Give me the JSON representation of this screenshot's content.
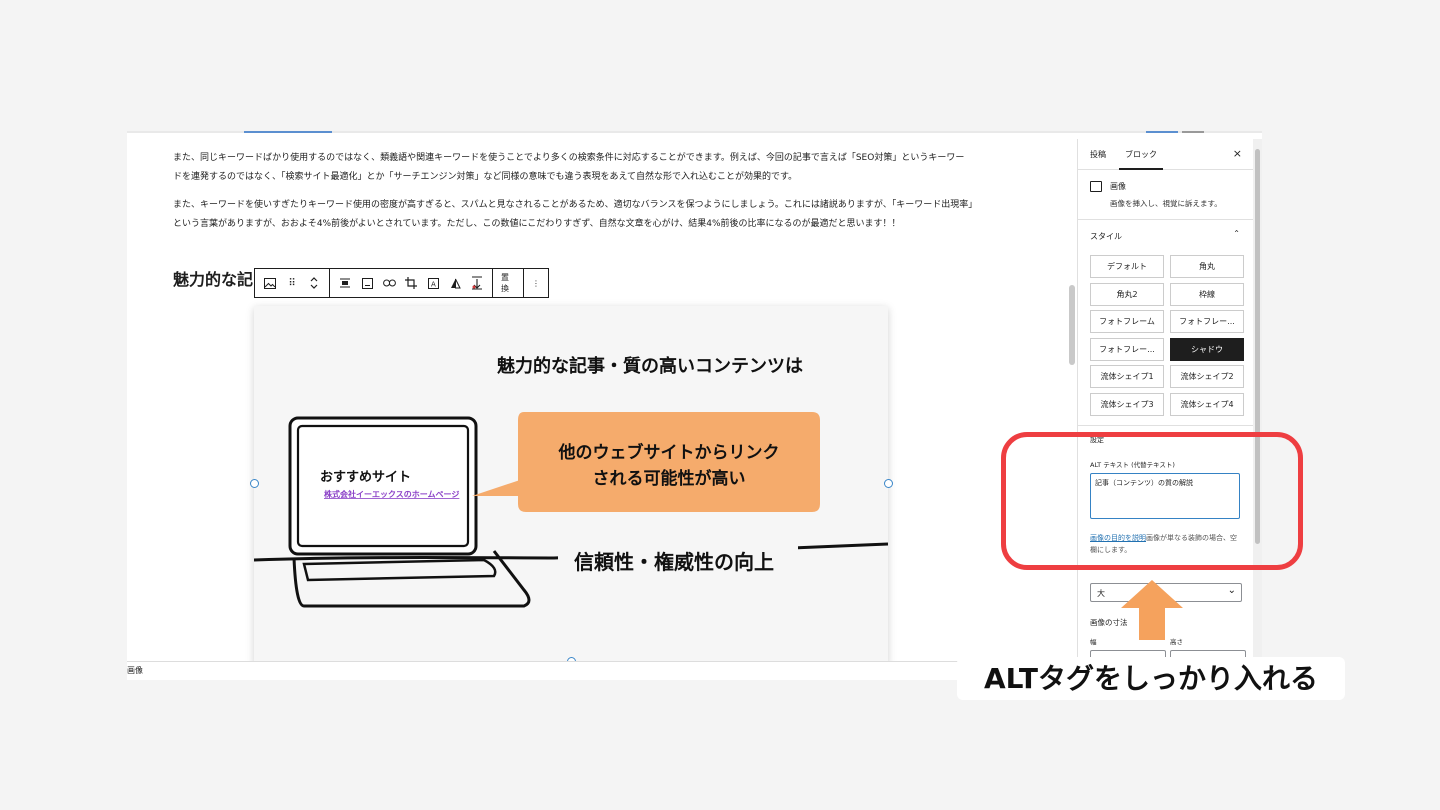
{
  "editor": {
    "paragraphs": [
      "また、同じキーワードばかり使用するのではなく、類義語や関連キーワードを使うことでより多くの検索条件に対応することができます。例えば、今回の記事で言えば「SEO対策」というキーワードを連発するのではなく、「検索サイト最適化」とか「サーチエンジン対策」など同様の意味でも違う表現をあえて自然な形で入れ込むことが効果的です。",
      "また、キーワードを使いすぎたりキーワード使用の密度が高すぎると、スパムと見なされることがあるため、適切なバランスを保つようにしましょう。これには諸説ありますが、「キーワード出現率」という言葉がありますが、おおよそ4%前後がよいとされています。ただし、この数値にこだわりすぎず、自然な文章を心がけ、結果4%前後の比率になるのが最適だと思います！！"
    ],
    "heading": "魅力的な記"
  },
  "toolbar": {
    "icons": [
      "image-icon",
      "drag-icon",
      "move-updown-icon",
      "align-icon",
      "caption-icon",
      "link-icon",
      "crop-icon",
      "text-overlay-icon",
      "duotone-icon",
      "upload-icon"
    ],
    "replace_label": "置換",
    "more_label": "⋮"
  },
  "image": {
    "title": "魅力的な記事・質の高いコンテンツは",
    "laptop_title": "おすすめサイト",
    "laptop_link": "株式会社イーエックスのホームページ",
    "bubble_line1": "他のウェブサイトからリンク",
    "bubble_line2": "される可能性が高い",
    "bottom_label": "信頼性・権威性の向上"
  },
  "statusbar": {
    "label": "画像"
  },
  "sidebar": {
    "tab_post": "投稿",
    "tab_block": "ブロック",
    "close": "×",
    "block_title": "画像",
    "block_desc": "画像を挿入し、視覚に訴えます。",
    "style_heading": "スタイル",
    "styles": [
      "デフォルト",
      "角丸",
      "角丸2",
      "枠線",
      "フォトフレーム",
      "フォトフレー...",
      "フォトフレー...",
      "シャドウ",
      "流体シェイプ1",
      "流体シェイプ2",
      "流体シェイプ3",
      "流体シェイプ4"
    ],
    "active_style": "シャドウ",
    "settings_heading": "設定",
    "alt_label": "ALT テキスト (代替テキスト)",
    "alt_value": "記事（コンテンツ）の質の解説",
    "alt_help_link": "画像の目的を説明",
    "alt_help_rest": "画像が単なる装飾の場合、空欄にします。",
    "size_value": "大",
    "dim_label": "画像の寸法",
    "width_label": "幅",
    "height_label": "高さ"
  },
  "annotation": {
    "caption": "ALTタグをしっかり入れる",
    "box_color": "#ee3e41",
    "arrow_color": "#f5a25d"
  },
  "colors": {
    "accent": "#3582c4",
    "bubble": "#f5ab6c",
    "link_purple": "#8a3fc7"
  }
}
